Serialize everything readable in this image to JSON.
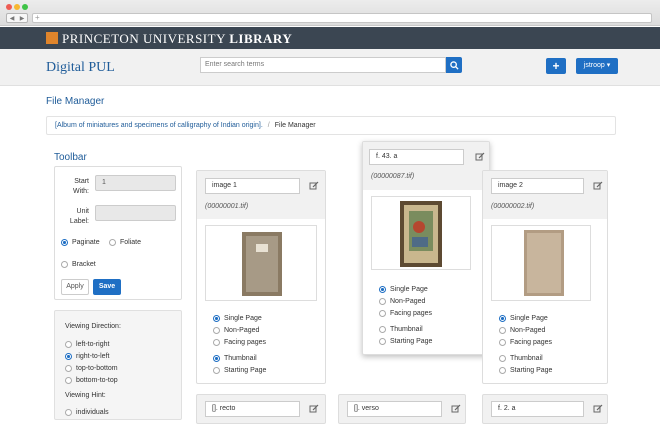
{
  "browser": {
    "new_tab": "+"
  },
  "brand": {
    "name_light": "PRINCETON UNIVERSITY",
    "name_bold": "LIBRARY",
    "site_title": "Digital PUL"
  },
  "search": {
    "placeholder": "Enter search terms"
  },
  "header_actions": {
    "add_label": "+",
    "user_label": "jstroop ▾"
  },
  "page": {
    "heading": "File Manager"
  },
  "breadcrumb": {
    "parent": "[Album of miniatures and specimens of calligraphy of Indian origin].",
    "separator": "/",
    "current": "File Manager"
  },
  "toolbar": {
    "title": "Toolbar",
    "start_with_label": "Start With:",
    "start_with_value": "1",
    "unit_label_label": "Unit Label:",
    "unit_label_value": "",
    "paginate": "Paginate",
    "foliate": "Foliate",
    "bracket": "Bracket",
    "apply": "Apply",
    "save": "Save"
  },
  "viewing": {
    "direction_title": "Viewing Direction:",
    "directions": [
      "left-to-right",
      "right-to-left",
      "top-to-bottom",
      "bottom-to-top"
    ],
    "selected_direction": "right-to-left",
    "hint_title": "Viewing Hint:",
    "hint_first": "individuals"
  },
  "cards": [
    {
      "label": "image 1",
      "filename": "(00000001.tif)",
      "hint": "Single Page",
      "thumbnail_checked": true
    },
    {
      "label": "f. 43. a",
      "filename": "(00000087.tif)",
      "hint": "Single Page",
      "thumbnail_checked": false
    },
    {
      "label": "image 2",
      "filename": "(00000002.tif)",
      "hint": "Single Page",
      "thumbnail_checked": false
    }
  ],
  "card_options": {
    "single": "Single Page",
    "nonpaged": "Non-Paged",
    "facing": "Facing pages",
    "thumbnail": "Thumbnail",
    "starting": "Starting Page"
  },
  "bottom_cards": [
    "[]. recto",
    "[]. verso",
    "f. 2. a"
  ],
  "colors": {
    "brand_blue": "#1f6fc4",
    "title_blue": "#1f5c99",
    "nav_dark": "#3b4652",
    "logo_orange": "#e0852b"
  }
}
